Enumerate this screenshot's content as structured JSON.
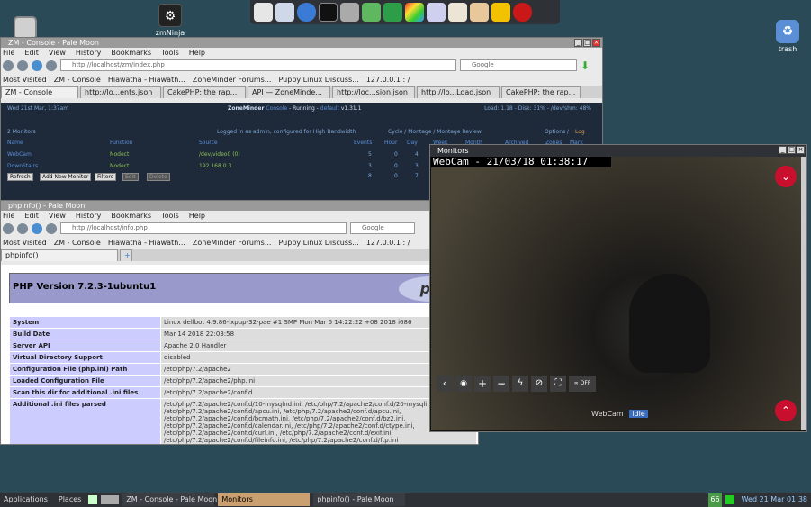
{
  "desktop": {
    "app_icon_label": "zmNinja",
    "trash_label": "trash"
  },
  "zm_window": {
    "title": "ZM - Console - Pale Moon",
    "menu": [
      "File",
      "Edit",
      "View",
      "History",
      "Bookmarks",
      "Tools",
      "Help"
    ],
    "url": "http://localhost/zm/index.php",
    "search_placeholder": "Google",
    "bookmarks": [
      "Most Visited",
      "ZM - Console",
      "Hiawatha - Hiawath...",
      "ZoneMinder Forums...",
      "Puppy Linux Discuss...",
      "127.0.0.1 : /"
    ],
    "tabs": [
      "ZM - Console",
      "http://lo...ents.json",
      "CakePHP: the rap...",
      "API — ZoneMinde...",
      "http://loc...sion.json",
      "http://lo...Load.json",
      "CakePHP: the rap..."
    ],
    "header_date": "Wed 21st Mar, 1:37am",
    "header_brand": "ZoneMinder",
    "header_console": "Console",
    "header_status": "- Running -",
    "header_state": "default",
    "header_version": "v1.31.1",
    "header_load": "Load: 1.18 - Disk: 31% - /dev/shm: 48%",
    "monitors_count": "2 Monitors",
    "logged_in": "Logged in as admin, configured for High Bandwidth",
    "view_links": "Cycle / Montage / Montage Review",
    "options_links": "Options /",
    "log_link": "Log",
    "columns": [
      "Name",
      "Function",
      "Source",
      "Events",
      "Hour",
      "Day",
      "Week",
      "Month",
      "Archived",
      "Zones",
      "Mark"
    ],
    "rows": [
      {
        "name": "WebCam",
        "function": "Nodect",
        "source": "/dev/video0 (0)",
        "events": "5",
        "hour": "0",
        "day": "4"
      },
      {
        "name": "DownStairs",
        "function": "Nodect",
        "source": "192.168.0.3",
        "events": "3",
        "hour": "0",
        "day": "3"
      }
    ],
    "totals": {
      "events": "8",
      "hour": "0",
      "day": "7"
    },
    "buttons": [
      "Refresh",
      "Add New Monitor",
      "Filters",
      "Edit",
      "Delete"
    ]
  },
  "php_window": {
    "title": "phpinfo() - Pale Moon",
    "menu": [
      "File",
      "Edit",
      "View",
      "History",
      "Bookmarks",
      "Tools",
      "Help"
    ],
    "url": "http://localhost/info.php",
    "search_placeholder": "Google",
    "bookmarks": [
      "Most Visited",
      "ZM - Console",
      "Hiawatha - Hiawath...",
      "ZoneMinder Forums...",
      "Puppy Linux Discuss...",
      "127.0.0.1 : /"
    ],
    "tab": "phpinfo()",
    "heading": "PHP Version 7.2.3-1ubuntu1",
    "logo_text": "ph",
    "rows": [
      {
        "k": "System",
        "v": "Linux dellbot 4.9.86-lxpup-32-pae #1 SMP Mon Mar 5 14:22:22 +08 2018 i686"
      },
      {
        "k": "Build Date",
        "v": "Mar 14 2018 22:03:58"
      },
      {
        "k": "Server API",
        "v": "Apache 2.0 Handler"
      },
      {
        "k": "Virtual Directory Support",
        "v": "disabled"
      },
      {
        "k": "Configuration File (php.ini) Path",
        "v": "/etc/php/7.2/apache2"
      },
      {
        "k": "Loaded Configuration File",
        "v": "/etc/php/7.2/apache2/php.ini"
      },
      {
        "k": "Scan this dir for additional .ini files",
        "v": "/etc/php/7.2/apache2/conf.d"
      },
      {
        "k": "Additional .ini files parsed",
        "v": "/etc/php/7.2/apache2/conf.d/10-mysqlnd.ini, /etc/php/7.2/apache2/conf.d/20-mysqli.ini, /etc/php/7.2/apache2/conf.d/apcu.ini, /etc/php/7.2/apache2/conf.d/apcu.ini, /etc/php/7.2/apache2/conf.d/bcmath.ini, /etc/php/7.2/apache2/conf.d/bz2.ini, /etc/php/7.2/apache2/conf.d/calendar.ini, /etc/php/7.2/apache2/conf.d/ctype.ini, /etc/php/7.2/apache2/conf.d/curl.ini, /etc/php/7.2/apache2/conf.d/exif.ini, /etc/php/7.2/apache2/conf.d/fileinfo.ini, /etc/php/7.2/apache2/conf.d/ftp.ini"
      }
    ]
  },
  "monitors_window": {
    "title": "Monitors",
    "overlay_timestamp": "WebCam - 21/03/18 01:38:17",
    "camera_name": "WebCam",
    "camera_state": "idle",
    "toolbar": [
      "back",
      "camera",
      "zoom-in",
      "zoom-out",
      "flash",
      "no-entry",
      "fullscreen",
      "cycle-off"
    ],
    "cycle_label": "OFF"
  },
  "taskbar": {
    "applications": "Applications",
    "places": "Places",
    "tasks": [
      "ZM - Console - Pale Moon",
      "Monitors",
      "phpinfo() - Pale Moon"
    ],
    "battery": "66",
    "clock": "Wed 21 Mar 01:38"
  },
  "colors": {
    "desktop": "#2a4a57",
    "zm_bg": "#1e2a3a",
    "zm_link": "#5b8fd8",
    "zm_green": "#8fbf5a",
    "zm_orange": "#e0a040",
    "php_heading_bg": "#9999cc",
    "php_key_bg": "#ccccff",
    "php_val_bg": "#dddddd",
    "fab_red": "#c8102e"
  }
}
